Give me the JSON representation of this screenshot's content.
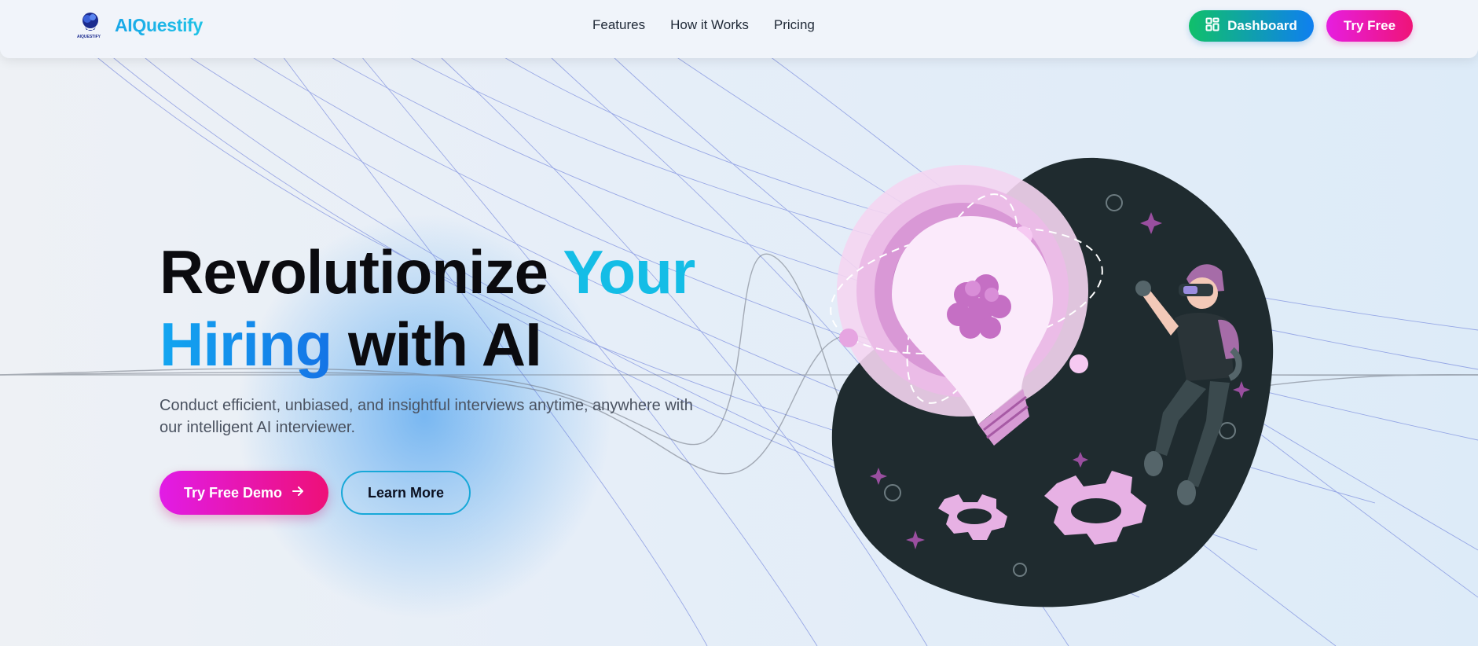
{
  "header": {
    "brand": "AIQuestify",
    "logo_tiny_text": "AIQUESTIFY",
    "nav": [
      "Features",
      "How it Works",
      "Pricing"
    ],
    "dashboard_label": "Dashboard",
    "try_free_label": "Try Free"
  },
  "hero": {
    "title_part1": "Revolutionize ",
    "title_part2": "Your",
    "title_part3": "Hiring",
    "title_part4": " with AI",
    "subtitle": "Conduct efficient, unbiased, and insightful interviews anytime, anywhere with our intelligent AI interviewer.",
    "primary_cta": "Try Free Demo",
    "secondary_cta": "Learn More"
  },
  "icons": {
    "logo": "brain-head-icon",
    "dashboard": "grid-icon",
    "arrow": "arrow-right-icon"
  },
  "colors": {
    "brand_cyan": "#14bde6",
    "brand_blue": "#1473e6",
    "accent_magenta": "#e11ce6",
    "accent_pink": "#ee1078",
    "dashboard_green": "#10c06a",
    "illustration_dark": "#1f2b2f",
    "illustration_pink": "#e9b7e6"
  }
}
